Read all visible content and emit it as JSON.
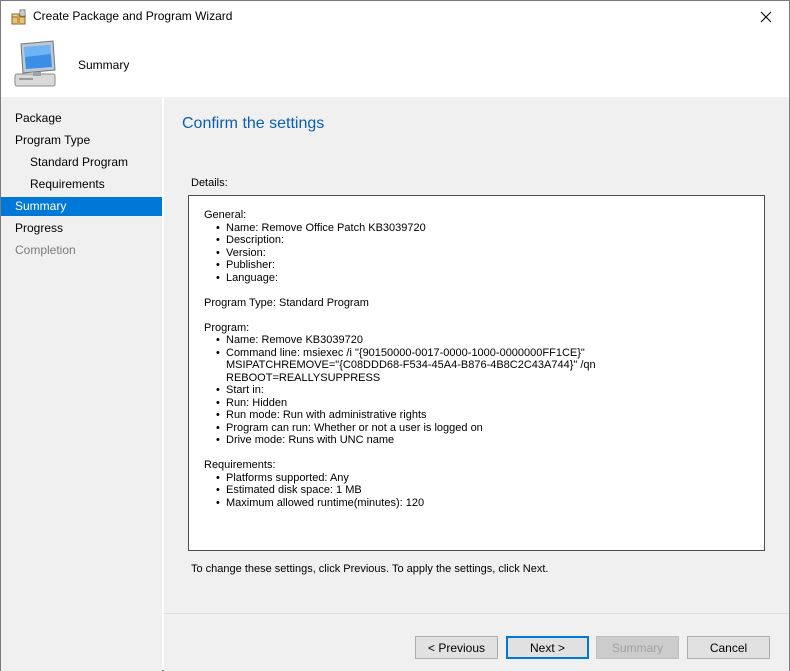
{
  "window": {
    "title": "Create Package and Program Wizard"
  },
  "header": {
    "title": "Summary",
    "icon": "computer-icon"
  },
  "nav": {
    "items": [
      {
        "label": "Package",
        "level": 0,
        "state": "normal"
      },
      {
        "label": "Program Type",
        "level": 0,
        "state": "normal"
      },
      {
        "label": "Standard Program",
        "level": 1,
        "state": "normal"
      },
      {
        "label": "Requirements",
        "level": 1,
        "state": "normal"
      },
      {
        "label": "Summary",
        "level": 0,
        "state": "active"
      },
      {
        "label": "Progress",
        "level": 0,
        "state": "normal"
      },
      {
        "label": "Completion",
        "level": 0,
        "state": "disabled"
      }
    ]
  },
  "main": {
    "title": "Confirm the settings",
    "details_label": "Details:",
    "details": {
      "general": {
        "heading": "General:",
        "items": [
          "Name: Remove Office Patch KB3039720",
          "Description:",
          "Version:",
          "Publisher:",
          "Language:"
        ]
      },
      "program_type": "Program Type: Standard Program",
      "program": {
        "heading": "Program:",
        "items": [
          "Name: Remove KB3039720",
          "Command line: msiexec /i \"{90150000-0017-0000-1000-0000000FF1CE}\" MSIPATCHREMOVE=\"{C08DDD68-F534-45A4-B876-4B8C2C43A744}\" /qn REBOOT=REALLYSUPPRESS",
          "Start in:",
          "Run: Hidden",
          "Run mode: Run with administrative rights",
          "Program can run: Whether or not a user is logged on",
          "Drive mode: Runs with UNC name"
        ]
      },
      "requirements": {
        "heading": "Requirements:",
        "items": [
          "Platforms supported: Any",
          "Estimated disk space: 1 MB",
          "Maximum allowed runtime(minutes): 120"
        ]
      }
    },
    "footer_hint": "To change these settings, click Previous. To apply the settings, click Next."
  },
  "buttons": {
    "previous": "< Previous",
    "next": "Next >",
    "summary": "Summary",
    "cancel": "Cancel"
  },
  "colors": {
    "accent": "#0078d7",
    "title_blue": "#0b5fae"
  }
}
